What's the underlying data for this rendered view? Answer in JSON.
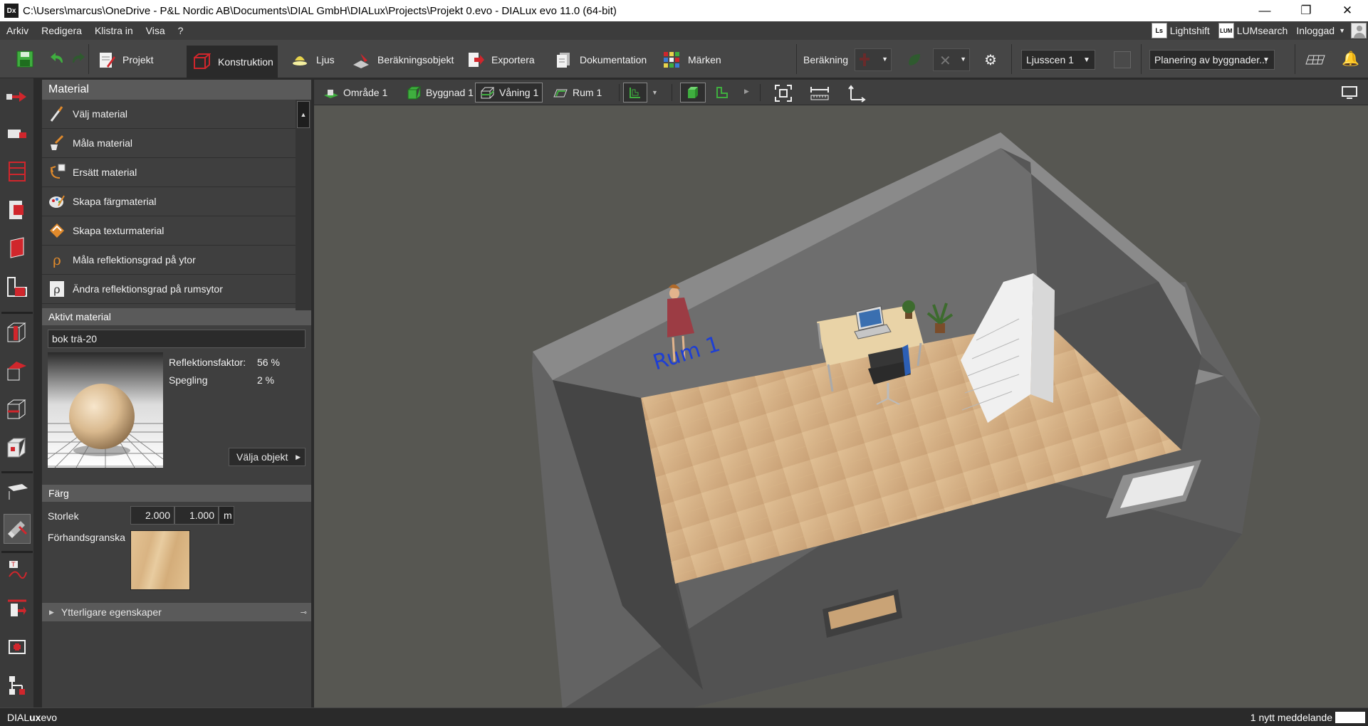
{
  "window": {
    "app_icon_label": "Dx",
    "title": "C:\\Users\\marcus\\OneDrive - P&L Nordic AB\\Documents\\DIAL GmbH\\DIALux\\Projects\\Projekt 0.evo - DIALux evo 11.0  (64-bit)",
    "minimize_glyph": "—",
    "maximize_glyph": "❐",
    "close_glyph": "✕"
  },
  "menu": {
    "items": [
      "Arkiv",
      "Redigera",
      "Klistra in",
      "Visa",
      "?"
    ],
    "lightshift_logo": "Ls",
    "lightshift": "Lightshift",
    "lumsearch_logo": "LUM",
    "lumsearch": "LUMsearch",
    "login": "Inloggad"
  },
  "toolbar": {
    "tabs": [
      "Projekt",
      "Konstruktion",
      "Ljus",
      "Beräkningsobjekt",
      "Exportera",
      "Dokumentation",
      "Märken"
    ],
    "active_tab": "Konstruktion",
    "calc_label": "Beräkning",
    "light_scene": "Ljusscen 1",
    "planning": "Planering av byggnader..."
  },
  "panel": {
    "title": "Material",
    "items": [
      {
        "label": "Välj material",
        "icon": "pipette-icon"
      },
      {
        "label": "Måla material",
        "icon": "paint-bucket-icon"
      },
      {
        "label": "Ersätt material",
        "icon": "replace-icon"
      },
      {
        "label": "Skapa färgmaterial",
        "icon": "palette-icon"
      },
      {
        "label": "Skapa texturmaterial",
        "icon": "texture-icon"
      },
      {
        "label": "Måla reflektionsgrad på ytor",
        "icon": "reflectance-paint-icon"
      },
      {
        "label": "Ändra reflektionsgrad på rumsytor",
        "icon": "reflectance-change-icon"
      }
    ],
    "active_material": {
      "header": "Aktivt material",
      "name": "bok trä-20",
      "reflection_label": "Reflektionsfaktor:",
      "reflection_value": "56 %",
      "gloss_label": "Spegling",
      "gloss_value": "2 %",
      "select_objects": "Välja objekt"
    },
    "color": {
      "header": "Färg",
      "size_label": "Storlek",
      "size_x": "2.000",
      "size_y": "1.000",
      "unit": "m",
      "preview_label": "Förhandsgranska"
    },
    "more_properties": "Ytterligare egenskaper"
  },
  "viewport_toolbar": {
    "crumbs": [
      "Område 1",
      "Byggnad 1",
      "Våning 1",
      "Rum 1"
    ],
    "active_crumb": "Våning 1"
  },
  "scene": {
    "room_label": "Rum 1"
  },
  "status": {
    "brand_prefix": "DIAL",
    "brand_bold": "ux",
    "brand_suffix": "evo",
    "message": "1 nytt meddelande"
  }
}
